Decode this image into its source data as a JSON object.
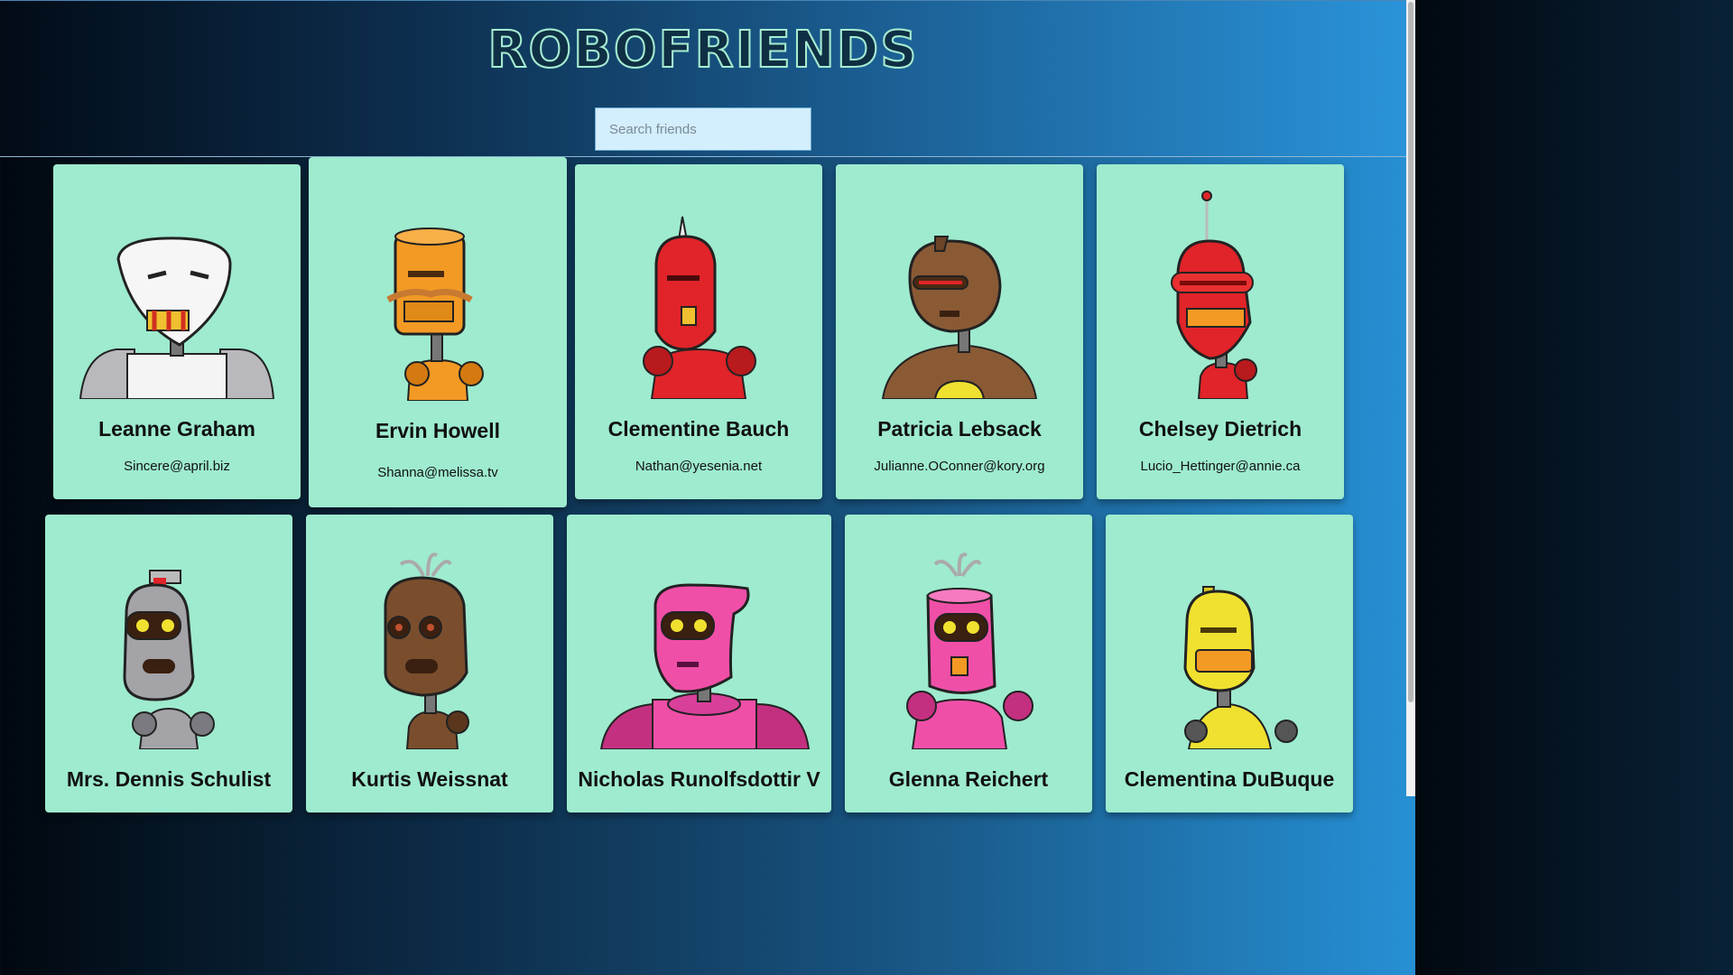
{
  "app": {
    "title": "ROBOFRIENDS",
    "search_placeholder": "Search friends",
    "search_value": ""
  },
  "robots": [
    {
      "name": "Leanne Graham",
      "email": "Sincere@april.biz",
      "color": "#eeeeee"
    },
    {
      "name": "Ervin Howell",
      "email": "Shanna@melissa.tv",
      "color": "#f39a25"
    },
    {
      "name": "Clementine Bauch",
      "email": "Nathan@yesenia.net",
      "color": "#e02429"
    },
    {
      "name": "Patricia Lebsack",
      "email": "Julianne.OConner@kory.org",
      "color": "#8a5a35"
    },
    {
      "name": "Chelsey Dietrich",
      "email": "Lucio_Hettinger@annie.ca",
      "color": "#e02429"
    },
    {
      "name": "Mrs. Dennis Schulist",
      "email": "",
      "color": "#a3a3a8"
    },
    {
      "name": "Kurtis Weissnat",
      "email": "",
      "color": "#7a4e2d"
    },
    {
      "name": "Nicholas Runolfsdottir V",
      "email": "",
      "color": "#f04fa8"
    },
    {
      "name": "Glenna Reichert",
      "email": "",
      "color": "#f04fa8"
    },
    {
      "name": "Clementina DuBuque",
      "email": "",
      "color": "#f0e130"
    }
  ]
}
